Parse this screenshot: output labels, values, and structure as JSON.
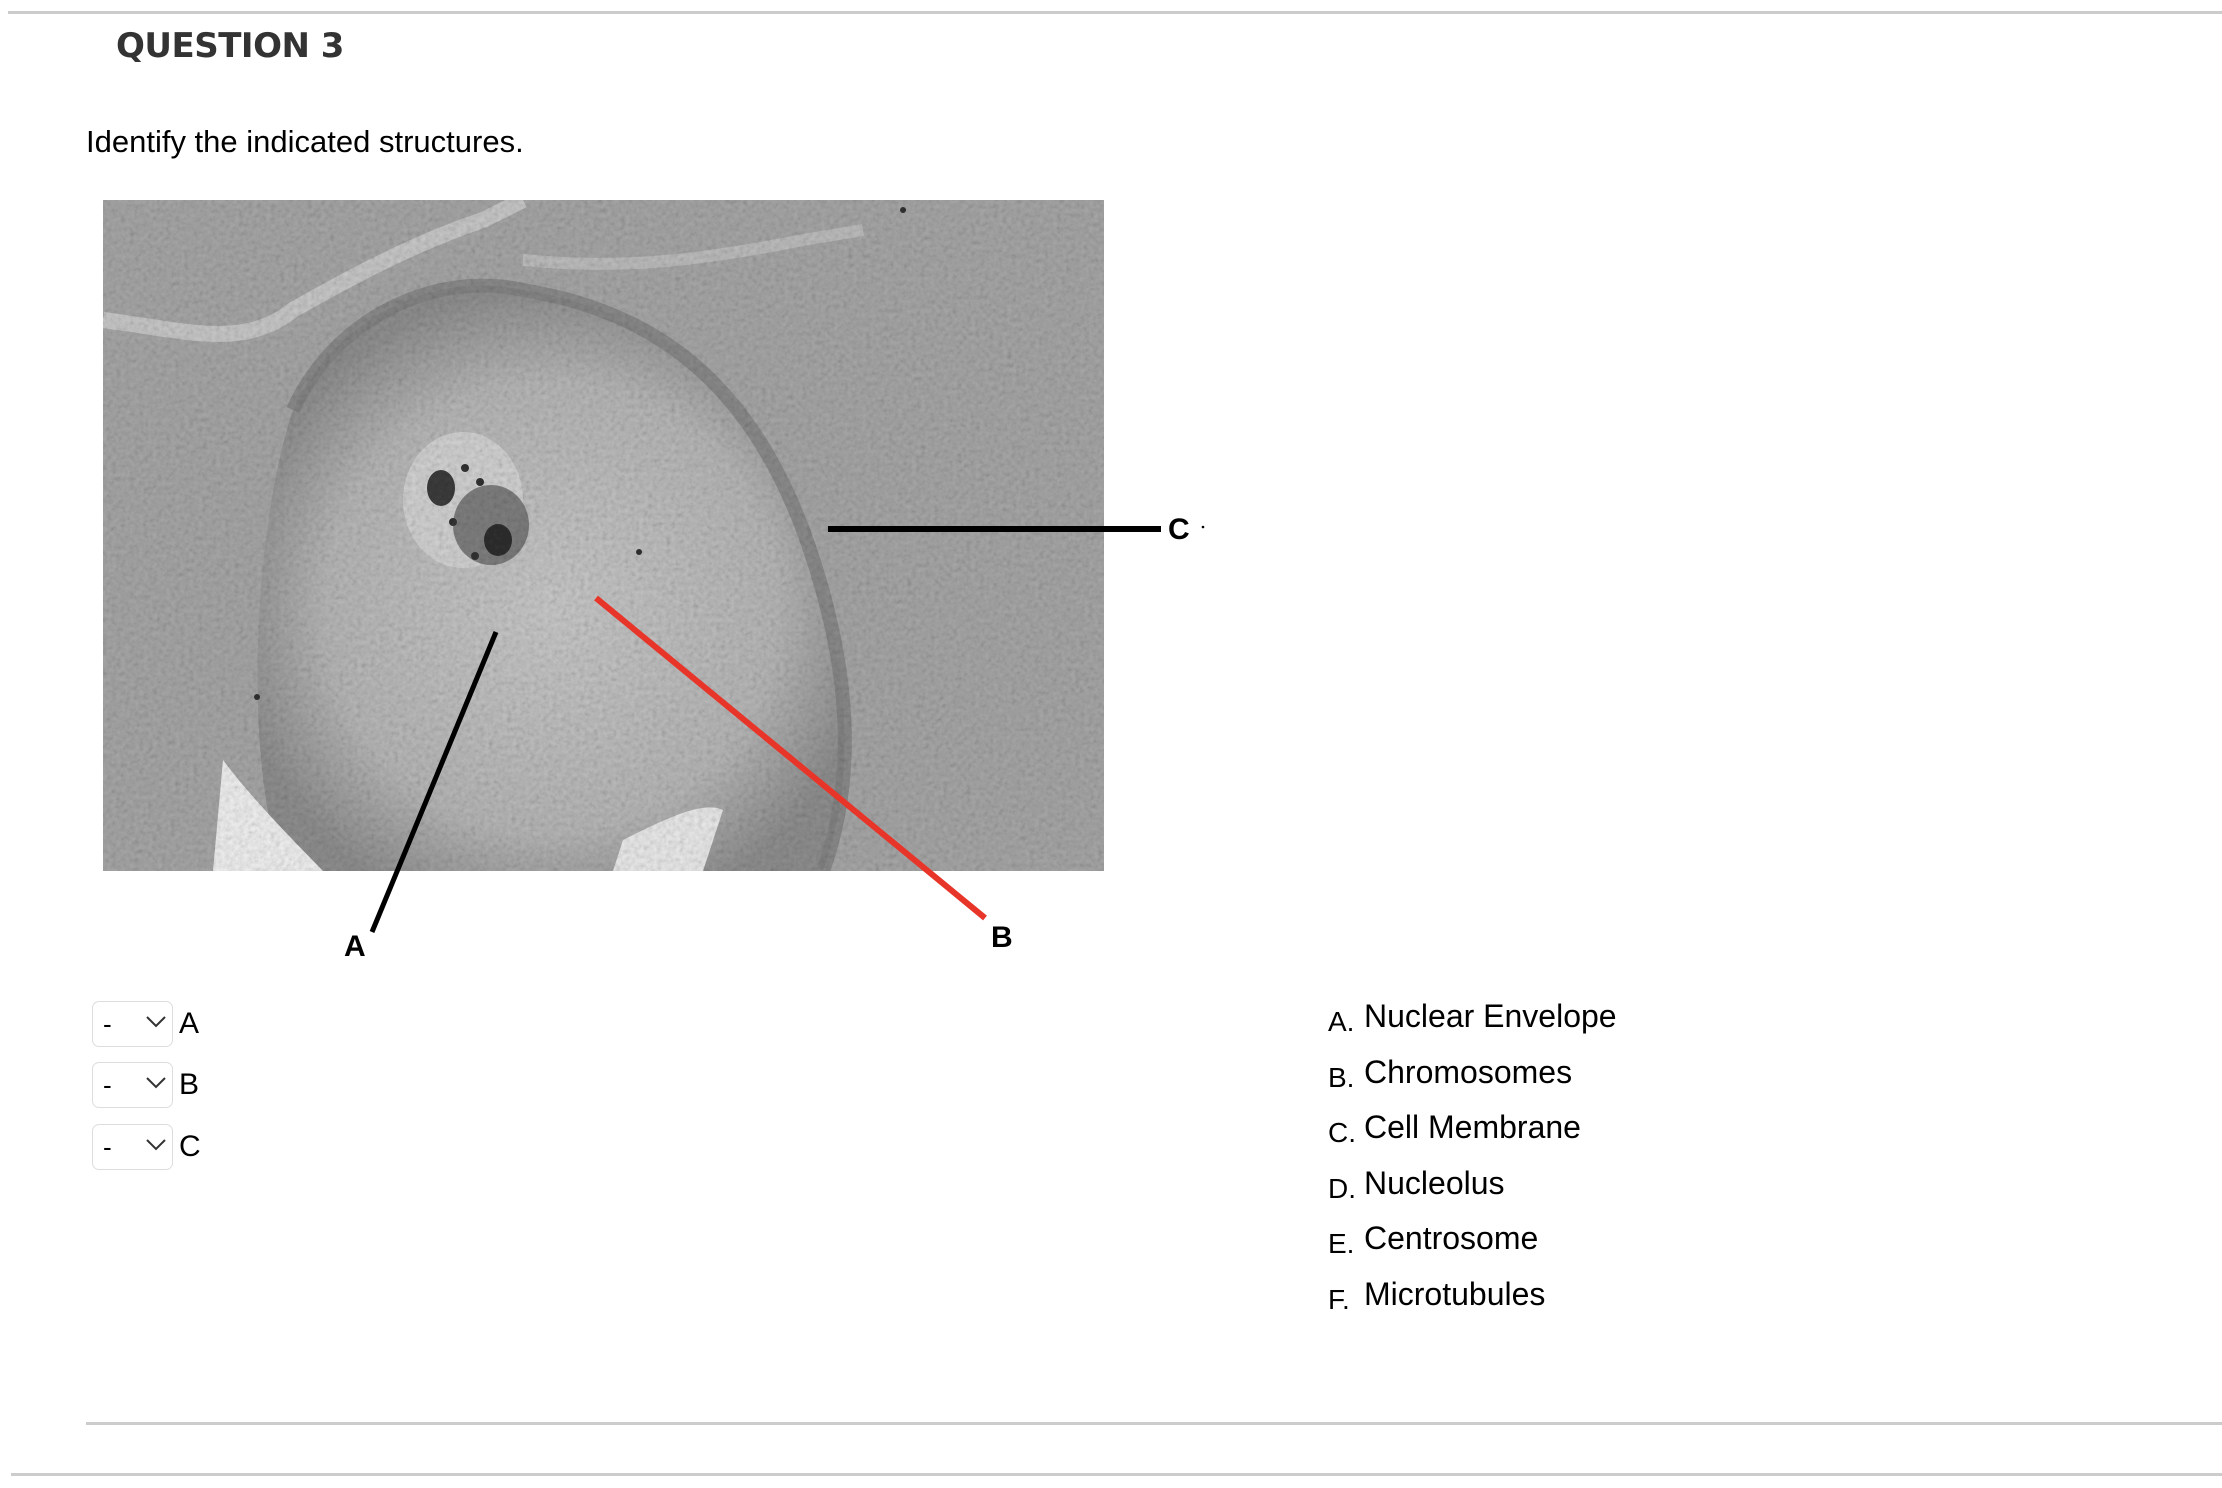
{
  "question": {
    "title": "QUESTION 3",
    "prompt": "Identify the indicated structures."
  },
  "figure": {
    "description": "micrograph-of-dividing-cell",
    "labels": [
      {
        "id": "A",
        "text": "A",
        "line_color": "#000000"
      },
      {
        "id": "B",
        "text": "B",
        "line_color": "#e8352a"
      },
      {
        "id": "C",
        "text": "C",
        "line_color": "#000000"
      }
    ]
  },
  "matching": {
    "rows": [
      {
        "selected": "-",
        "label": "A"
      },
      {
        "selected": "-",
        "label": "B"
      },
      {
        "selected": "-",
        "label": "C"
      }
    ]
  },
  "answers": [
    {
      "letter": "A.",
      "text": "Nuclear Envelope"
    },
    {
      "letter": "B.",
      "text": "Chromosomes"
    },
    {
      "letter": "C.",
      "text": "Cell Membrane"
    },
    {
      "letter": "D.",
      "text": "Nucleolus"
    },
    {
      "letter": "E.",
      "text": "Centrosome"
    },
    {
      "letter": "F.",
      "text": "Microtubules"
    }
  ],
  "colors": {
    "separator": "#cccccc",
    "title": "#333333",
    "select_border": "#dddddd",
    "pointer_red": "#e8352a"
  }
}
